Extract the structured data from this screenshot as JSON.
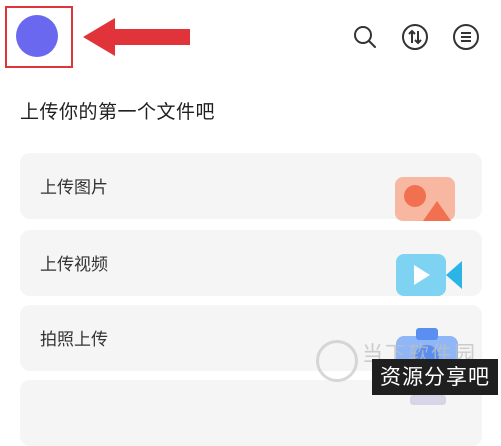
{
  "header": {
    "icons": [
      "avatar",
      "search-icon",
      "sort-icon",
      "menu-icon"
    ]
  },
  "main": {
    "section_title": "上传你的第一个文件吧",
    "cards": [
      {
        "label": "上传图片",
        "icon": "image-upload-icon"
      },
      {
        "label": "上传视频",
        "icon": "video-upload-icon"
      },
      {
        "label": "拍照上传",
        "icon": "camera-icon"
      },
      {
        "label": "",
        "icon": "document-icon"
      }
    ]
  },
  "watermark": {
    "text": "当下软件园",
    "badge": "资源分享吧"
  },
  "colors": {
    "avatar": "#6a68ef",
    "highlight_red": "#e0343a",
    "image_icon": "#f39a80",
    "video_icon": "#2ab5e6",
    "camera_icon": "#5a8ef0"
  }
}
